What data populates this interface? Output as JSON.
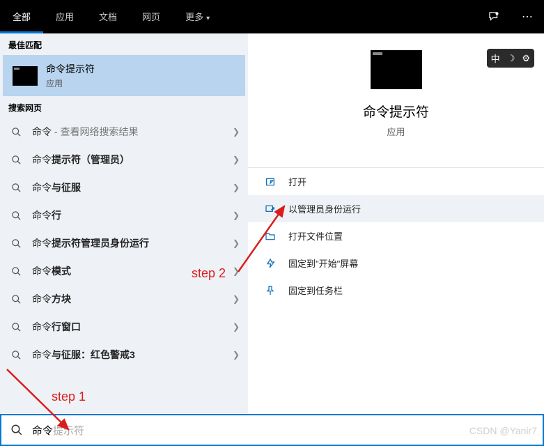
{
  "topbar": {
    "tabs": [
      "全部",
      "应用",
      "文档",
      "网页",
      "更多"
    ],
    "more_has_chevron": true
  },
  "left": {
    "best_match_hdr": "最佳匹配",
    "best": {
      "title": "命令提示符",
      "sub": "应用"
    },
    "web_hdr": "搜索网页",
    "rows": [
      {
        "prefix": "命令",
        "bold": "",
        "suffix": " - 查看网络搜索结果",
        "light_suffix": true
      },
      {
        "prefix": "命令",
        "bold": "提示符（管理员）",
        "suffix": ""
      },
      {
        "prefix": "命令",
        "bold": "与征服",
        "suffix": ""
      },
      {
        "prefix": "命令",
        "bold": "行",
        "suffix": ""
      },
      {
        "prefix": "命令",
        "bold": "提示符管理员身份运行",
        "suffix": ""
      },
      {
        "prefix": "命令",
        "bold": "模式",
        "suffix": ""
      },
      {
        "prefix": "命令",
        "bold": "方块",
        "suffix": ""
      },
      {
        "prefix": "命令",
        "bold": "行窗口",
        "suffix": ""
      },
      {
        "prefix": "命令",
        "bold": "与征服：红色警戒3",
        "suffix": ""
      }
    ]
  },
  "right": {
    "title": "命令提示符",
    "sub": "应用",
    "ime": {
      "lang": "中",
      "moon": "☽",
      "gear": "⚙"
    },
    "actions": [
      {
        "icon": "open",
        "label": "打开"
      },
      {
        "icon": "admin",
        "label": "以管理员身份运行",
        "hover": true
      },
      {
        "icon": "folder",
        "label": "打开文件位置"
      },
      {
        "icon": "pin-start",
        "label": "固定到\"开始\"屏幕"
      },
      {
        "icon": "pin-tb",
        "label": "固定到任务栏"
      }
    ]
  },
  "search": {
    "entered": "命令",
    "ghost": "提示符"
  },
  "annotations": {
    "step1": "step 1",
    "step2": "step 2",
    "watermark": "CSDN @Yanir7"
  }
}
